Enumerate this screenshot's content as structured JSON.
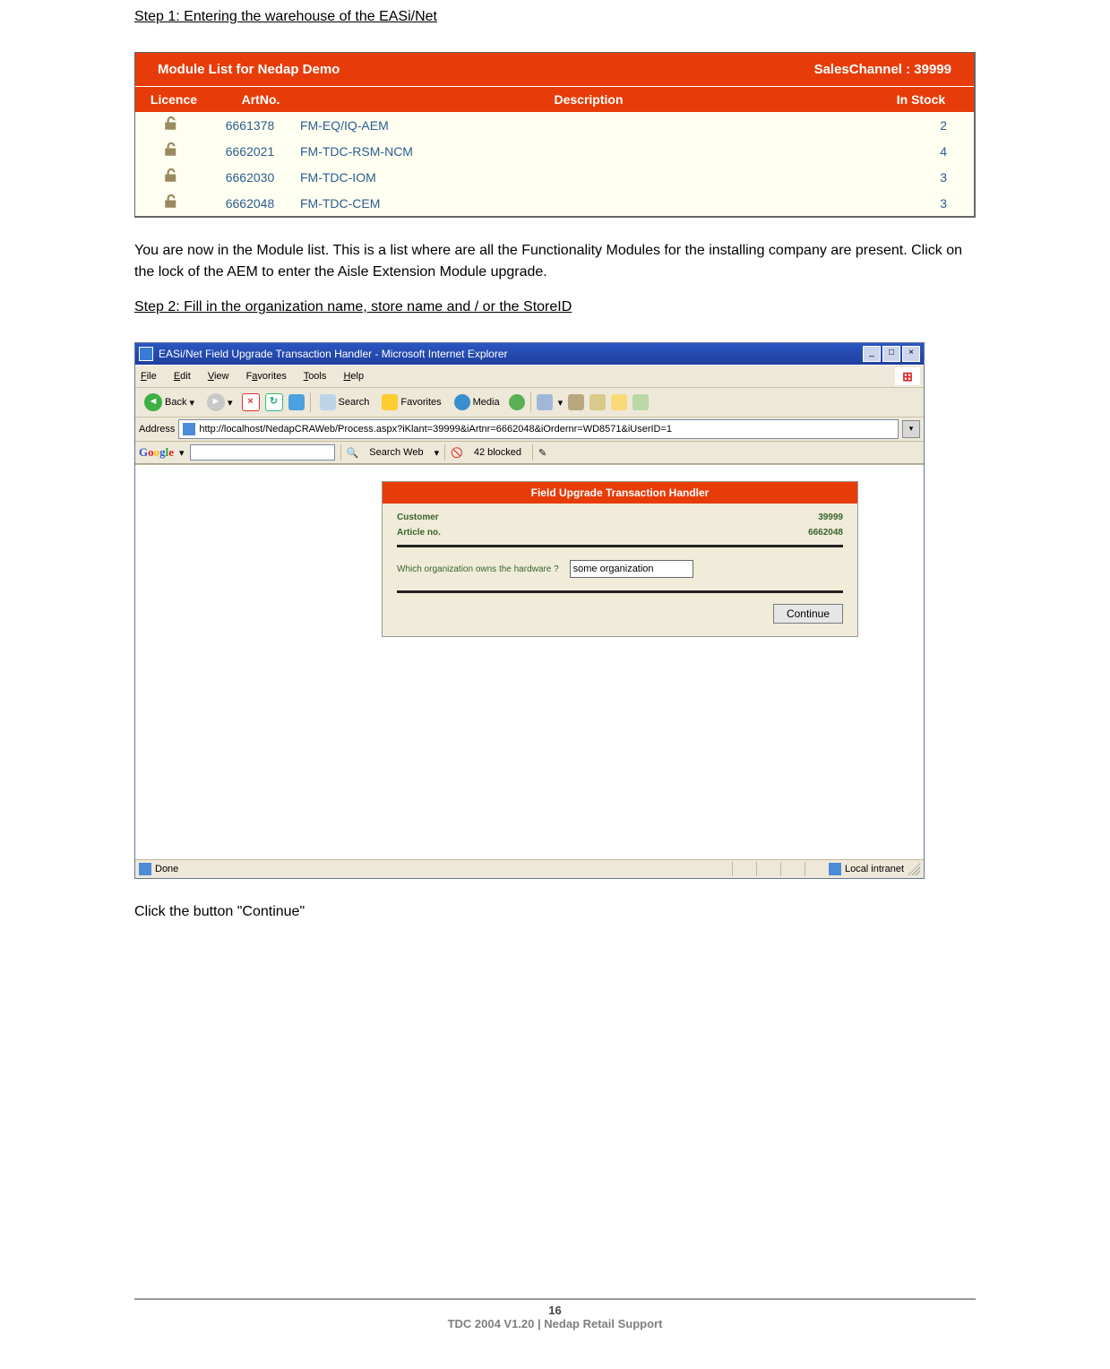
{
  "steps": {
    "step1_heading": "Step 1: Entering the warehouse of the EASi/Net",
    "module_header_left": "Module List for Nedap Demo",
    "module_header_right": "SalesChannel : 39999",
    "columns": {
      "licence": "Licence",
      "artno": "ArtNo.",
      "desc": "Description",
      "stock": "In Stock"
    },
    "rows": [
      {
        "artno": "6661378",
        "desc": "FM-EQ/IQ-AEM",
        "stock": "2"
      },
      {
        "artno": "6662021",
        "desc": "FM-TDC-RSM-NCM",
        "stock": "4"
      },
      {
        "artno": "6662030",
        "desc": "FM-TDC-IOM",
        "stock": "3"
      },
      {
        "artno": "6662048",
        "desc": "FM-TDC-CEM",
        "stock": "3"
      }
    ],
    "step1_para": "You are now in the Module list. This is a list where are all the Functionality Modules for the installing company are present. Click on the lock of the AEM to enter the Aisle Extension Module upgrade.",
    "step2_heading": "Step 2: Fill in the organization name, store name and / or the StoreID"
  },
  "browser": {
    "title": "EASi/Net Field Upgrade Transaction Handler - Microsoft Internet Explorer",
    "menu": {
      "file": "File",
      "edit": "Edit",
      "view": "View",
      "favorites": "Favorites",
      "tools": "Tools",
      "help": "Help"
    },
    "toolbar": {
      "back": "Back",
      "search": "Search",
      "favorites": "Favorites",
      "media": "Media"
    },
    "address_label": "Address",
    "address_url": "http://localhost/NedapCRAWeb/Process.aspx?iKlant=39999&iArtnr=6662048&iOrdernr=WD8571&iUserID=1",
    "google": {
      "label": "Google",
      "search_web": "Search Web",
      "blocked": "42 blocked"
    },
    "panel": {
      "header": "Field Upgrade Transaction Handler",
      "customer_label": "Customer",
      "customer_value": "39999",
      "article_label": "Article no.",
      "article_value": "6662048",
      "org_question": "Which organization owns the hardware ?",
      "org_value": "some organization",
      "continue": "Continue"
    },
    "status_done": "Done",
    "status_zone": "Local intranet"
  },
  "after_browser_text": "Click the button \"Continue\"",
  "footer": {
    "page_num": "16",
    "text": "TDC 2004 V1.20 | Nedap Retail Support"
  }
}
